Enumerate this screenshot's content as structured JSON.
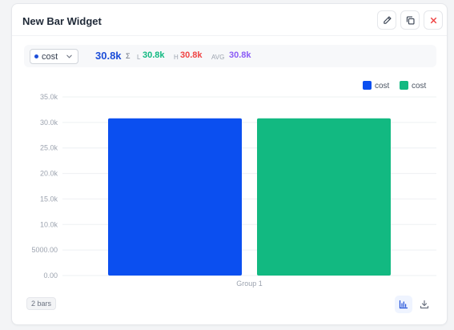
{
  "widget": {
    "title": "New Bar Widget",
    "footer_badge": "2 bars"
  },
  "header_buttons": {
    "edit_icon": "pencil-icon",
    "duplicate_icon": "copy-icon",
    "close_icon": "close-icon"
  },
  "stats": {
    "metric_select": "cost",
    "sum_value": "30.8k",
    "sum_symbol": "Σ",
    "low_label": "L",
    "low_value": "30.8k",
    "high_label": "H",
    "high_value": "30.8k",
    "avg_label": "AVG",
    "avg_value": "30.8k"
  },
  "colors": {
    "blue": "#0b4ff0",
    "green": "#12b981",
    "low": "#10b981",
    "high": "#ef4444",
    "avg": "#8b5cf6",
    "sum": "#1d4ed8"
  },
  "chart_data": {
    "type": "bar",
    "categories": [
      "Group 1"
    ],
    "series": [
      {
        "name": "cost",
        "values": [
          30800
        ],
        "color": "#0b4ff0"
      },
      {
        "name": "cost",
        "values": [
          30800
        ],
        "color": "#12b981"
      }
    ],
    "y_ticks": [
      "0.00",
      "5000.00",
      "10.0k",
      "15.0k",
      "20.0k",
      "25.0k",
      "30.0k",
      "35.0k"
    ],
    "ylim": [
      0,
      35000
    ],
    "legend": "top-right",
    "grid": true
  }
}
